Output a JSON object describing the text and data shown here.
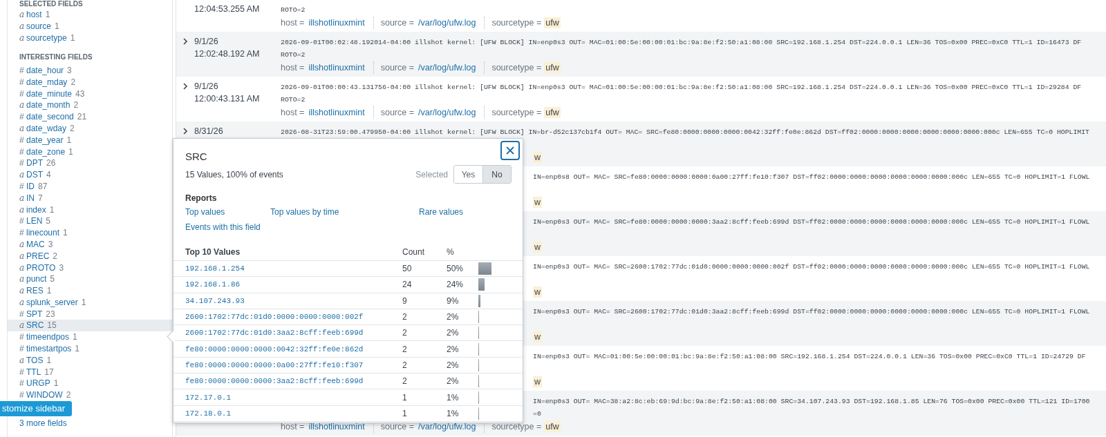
{
  "sidebar": {
    "selected_header": "SELECTED FIELDS",
    "selected_fields": [
      {
        "type_glyph": "a",
        "name": "host",
        "count": "1",
        "selected": false
      },
      {
        "type_glyph": "a",
        "name": "source",
        "count": "1",
        "selected": false
      },
      {
        "type_glyph": "a",
        "name": "sourcetype",
        "count": "1",
        "selected": false
      }
    ],
    "interesting_header": "INTERESTING FIELDS",
    "interesting_fields": [
      {
        "type_glyph": "#",
        "name": "date_hour",
        "count": "3",
        "selected": false
      },
      {
        "type_glyph": "#",
        "name": "date_mday",
        "count": "2",
        "selected": false
      },
      {
        "type_glyph": "#",
        "name": "date_minute",
        "count": "43",
        "selected": false
      },
      {
        "type_glyph": "a",
        "name": "date_month",
        "count": "2",
        "selected": false
      },
      {
        "type_glyph": "#",
        "name": "date_second",
        "count": "21",
        "selected": false
      },
      {
        "type_glyph": "a",
        "name": "date_wday",
        "count": "2",
        "selected": false
      },
      {
        "type_glyph": "#",
        "name": "date_year",
        "count": "1",
        "selected": false
      },
      {
        "type_glyph": "#",
        "name": "date_zone",
        "count": "1",
        "selected": false
      },
      {
        "type_glyph": "#",
        "name": "DPT",
        "count": "26",
        "selected": false
      },
      {
        "type_glyph": "a",
        "name": "DST",
        "count": "4",
        "selected": false
      },
      {
        "type_glyph": "#",
        "name": "ID",
        "count": "87",
        "selected": false
      },
      {
        "type_glyph": "a",
        "name": "IN",
        "count": "7",
        "selected": false
      },
      {
        "type_glyph": "a",
        "name": "index",
        "count": "1",
        "selected": false
      },
      {
        "type_glyph": "#",
        "name": "LEN",
        "count": "5",
        "selected": false
      },
      {
        "type_glyph": "#",
        "name": "linecount",
        "count": "1",
        "selected": false
      },
      {
        "type_glyph": "a",
        "name": "MAC",
        "count": "3",
        "selected": false
      },
      {
        "type_glyph": "a",
        "name": "PREC",
        "count": "2",
        "selected": false
      },
      {
        "type_glyph": "a",
        "name": "PROTO",
        "count": "3",
        "selected": false
      },
      {
        "type_glyph": "a",
        "name": "punct",
        "count": "5",
        "selected": false
      },
      {
        "type_glyph": "a",
        "name": "RES",
        "count": "1",
        "selected": false
      },
      {
        "type_glyph": "a",
        "name": "splunk_server",
        "count": "1",
        "selected": false
      },
      {
        "type_glyph": "#",
        "name": "SPT",
        "count": "23",
        "selected": false
      },
      {
        "type_glyph": "a",
        "name": "SRC",
        "count": "15",
        "selected": true
      },
      {
        "type_glyph": "#",
        "name": "timeendpos",
        "count": "1",
        "selected": false
      },
      {
        "type_glyph": "#",
        "name": "timestartpos",
        "count": "1",
        "selected": false
      },
      {
        "type_glyph": "a",
        "name": "TOS",
        "count": "1",
        "selected": false
      },
      {
        "type_glyph": "#",
        "name": "TTL",
        "count": "17",
        "selected": false
      },
      {
        "type_glyph": "#",
        "name": "URGP",
        "count": "1",
        "selected": false
      },
      {
        "type_glyph": "#",
        "name": "WINDOW",
        "count": "2",
        "selected": false
      }
    ],
    "customize_button": "stomize sidebar",
    "more_fields_link": "3 more fields"
  },
  "events": [
    {
      "time": "12:04:53.255 AM",
      "line2": {
        "kind": "full",
        "text": "ROTO=2"
      },
      "fields": [
        {
          "label": "host =",
          "value": "illshotlinuxmint",
          "highlighted": false
        },
        {
          "label": "source =",
          "value": "/var/log/ufw.log",
          "highlighted": false
        },
        {
          "label": "sourcetype =",
          "value": "ufw",
          "highlighted": true
        }
      ]
    },
    {
      "date": "9/1/26",
      "time": "12:02:48.192 AM",
      "line1": {
        "kind": "full",
        "text": "2026-09-01T00:02:48.192014-04:00 illshot kernel: [UFW BLOCK] IN=enp0s3 OUT= MAC=01:00:5e:00:00:01:bc:9a:8e:f2:50:a1:08:00 SRC=192.168.1.254 DST=224.0.0.1 LEN=36 TOS=0x00 PREC=0xC0 TTL=1 ID=16473 DF"
      },
      "line2": {
        "kind": "full",
        "text": "ROTO=2"
      },
      "fields": [
        {
          "label": "host =",
          "value": "illshotlinuxmint",
          "highlighted": false
        },
        {
          "label": "source =",
          "value": "/var/log/ufw.log",
          "highlighted": false
        },
        {
          "label": "sourcetype =",
          "value": "ufw",
          "highlighted": true
        }
      ]
    },
    {
      "date": "9/1/26",
      "time": "12:00:43.131 AM",
      "line1": {
        "kind": "full",
        "text": "2026-09-01T00:00:43.131756-04:00 illshot kernel: [UFW BLOCK] IN=enp0s3 OUT= MAC=01:00:5e:00:00:01:bc:9a:8e:f2:50:a1:08:00 SRC=192.168.1.254 DST=224.0.0.1 LEN=36 TOS=0x00 PREC=0xC0 TTL=1 ID=29284 DF"
      },
      "line2": {
        "kind": "full",
        "text": "ROTO=2"
      },
      "fields": [
        {
          "label": "host =",
          "value": "illshotlinuxmint",
          "highlighted": false
        },
        {
          "label": "source =",
          "value": "/var/log/ufw.log",
          "highlighted": false
        },
        {
          "label": "sourcetype =",
          "value": "ufw",
          "highlighted": true
        }
      ]
    },
    {
      "date": "8/31/26",
      "line1": {
        "kind": "full",
        "text": "2026-08-31T23:59:00.479950-04:00 illshot kernel: [UFW BLOCK] IN=br-d52c137cb1f4 OUT= MAC= SRC=fe80:0000:0000:0000:0042:32ff:fe0e:862d DST=ff02:0000:0000:0000:0000:0000:0000:000c LEN=655 TC=0 HOPLIMIT"
      },
      "fields_tail": "w"
    },
    {
      "line1": {
        "kind": "right_of_popup",
        "text": "IN=enp0s8 OUT= MAC= SRC=fe80:0000:0000:0000:0a00:27ff:fe10:f307 DST=ff02:0000:0000:0000:0000:0000:0000:000c LEN=655 TC=0 HOPLIMIT=1 FLOWL"
      },
      "fields_tail": "w"
    },
    {
      "line1": {
        "kind": "right_of_popup",
        "text": "IN=enp0s3 OUT= MAC= SRC=fe80:0000:0000:0000:3aa2:8cff:feeb:699d DST=ff02:0000:0000:0000:0000:0000:0000:000c LEN=655 TC=0 HOPLIMIT=1 FLOWL"
      },
      "fields_tail": "w"
    },
    {
      "line1": {
        "kind": "right_of_popup",
        "text": "IN=enp0s3 OUT= MAC= SRC=2600:1702:77dc:01d0:0000:0000:0000:002f DST=ff02:0000:0000:0000:0000:0000:0000:000c LEN=655 TC=0 HOPLIMIT=1 FLOWL"
      },
      "fields_tail": "w"
    },
    {
      "line1": {
        "kind": "right_of_popup",
        "text": "IN=enp0s3 OUT= MAC= SRC=2600:1702:77dc:01d0:3aa2:8cff:feeb:699d DST=ff02:0000:0000:0000:0000:0000:0000:000c LEN=655 TC=0 HOPLIMIT=1 FLOWL"
      },
      "fields_tail": "w"
    },
    {
      "line1": {
        "kind": "right_of_popup",
        "text": "IN=enp0s3 OUT= MAC=01:00:5e:00:00:01:bc:9a:8e:f2:50:a1:08:00 SRC=192.168.1.254 DST=224.0.0.1 LEN=36 TOS=0x00 PREC=0xC0 TTL=1 ID=24729 DF"
      },
      "fields_tail": "w"
    },
    {
      "line1": {
        "kind": "right_of_popup",
        "text": "IN=enp0s3 OUT= MAC=38:a2:8c:eb:69:9d:bc:9a:8e:f2:50:a1:08:00 SRC=34.107.243.93 DST=192.168.1.85 LEN=76 TOS=0x00 PREC=0x00 TTL=121 ID=1700"
      },
      "line2": {
        "kind": "right_of_popup",
        "text": "=0"
      },
      "fields": [
        {
          "label": "host =",
          "value": "illshotlinuxmint",
          "highlighted": false
        },
        {
          "label": "source =",
          "value": "/var/log/ufw.log",
          "highlighted": false
        },
        {
          "label": "sourcetype =",
          "value": "ufw",
          "highlighted": true
        }
      ]
    }
  ],
  "popup": {
    "title": "SRC",
    "summary": "15 Values, 100% of events",
    "selected_label": "Selected",
    "selected_options": [
      {
        "label": "Yes",
        "selected": false
      },
      {
        "label": "No",
        "selected": true
      }
    ],
    "reports_header": "Reports",
    "report_links": [
      "Top values",
      "Top values by time",
      "Rare values",
      "Events with this field"
    ],
    "table": {
      "columns": [
        "Top 10 Values",
        "Count",
        "%"
      ],
      "rows": [
        {
          "value": "192.168.1.254",
          "count": "50",
          "percent": "50%",
          "level": 0.5
        },
        {
          "value": "192.168.1.86",
          "count": "24",
          "percent": "24%",
          "level": 0.24
        },
        {
          "value": "34.107.243.93",
          "count": "9",
          "percent": "9%",
          "level": 0.09
        },
        {
          "value": "2600:1702:77dc:01d0:0000:0000:0000:002f",
          "count": "2",
          "percent": "2%",
          "level": 0.02
        },
        {
          "value": "2600:1702:77dc:01d0:3aa2:8cff:feeb:699d",
          "count": "2",
          "percent": "2%",
          "level": 0.02
        },
        {
          "value": "fe80:0000:0000:0000:0042:32ff:fe0e:862d",
          "count": "2",
          "percent": "2%",
          "level": 0.02
        },
        {
          "value": "fe80:0000:0000:0000:0a00:27ff:fe10:f307",
          "count": "2",
          "percent": "2%",
          "level": 0.02
        },
        {
          "value": "fe80:0000:0000:0000:3aa2:8cff:feeb:699d",
          "count": "2",
          "percent": "2%",
          "level": 0.02
        },
        {
          "value": "172.17.0.1",
          "count": "1",
          "percent": "1%",
          "level": 0.01
        },
        {
          "value": "172.18.0.1",
          "count": "1",
          "percent": "1%",
          "level": 0.01
        }
      ]
    }
  }
}
